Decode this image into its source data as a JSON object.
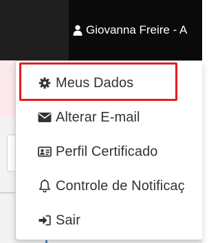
{
  "topbar": {
    "user_name": "Giovanna Freire - A",
    "user_icon": "user-icon"
  },
  "menu": {
    "items": [
      {
        "label": "Meus Dados",
        "icon": "gear-icon"
      },
      {
        "label": "Alterar E-mail",
        "icon": "envelope-icon"
      },
      {
        "label": "Perfil Certificado",
        "icon": "id-card-icon"
      },
      {
        "label": "Controle de Notificaç",
        "icon": "bell-icon"
      },
      {
        "label": "Sair",
        "icon": "sign-out-icon"
      }
    ],
    "highlighted_index": 0
  },
  "colors": {
    "topbar_bg": "#1f1f1f",
    "highlight": "#e8191f",
    "menu_text": "#333333"
  }
}
